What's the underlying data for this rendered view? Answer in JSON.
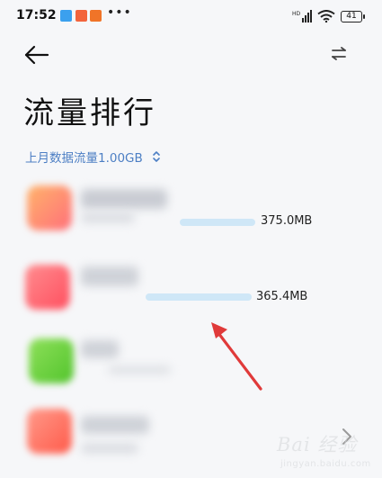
{
  "status_bar": {
    "time": "17:52",
    "dots": "•••",
    "battery": "41",
    "notification_icons": [
      "#3ba0ee",
      "#f3643c",
      "#f07428"
    ]
  },
  "header": {
    "back_icon": "arrow-left-icon",
    "switch_icon": "swap-arrows-icon"
  },
  "page_title": "流量排行",
  "summary": {
    "label": "上月数据流量1.00GB",
    "icon": "unfold-icon"
  },
  "apps": [
    {
      "usage": "375.0MB",
      "usage_fraction": 1.0,
      "icon_color": "#ff8a6a"
    },
    {
      "usage": "365.4MB",
      "usage_fraction": 0.974,
      "icon_color": "#ff5f6a"
    },
    {
      "icon_color": "#6ad23c"
    },
    {
      "icon_color": "#ff6a5a"
    }
  ],
  "colors": {
    "accent": "#4d7fc4",
    "usage_bar": "#cfe7f7",
    "annotation_arrow": "#e03a3a"
  },
  "watermark": {
    "main": "Bai 经验",
    "sub": "jingyan.baidu.com"
  }
}
